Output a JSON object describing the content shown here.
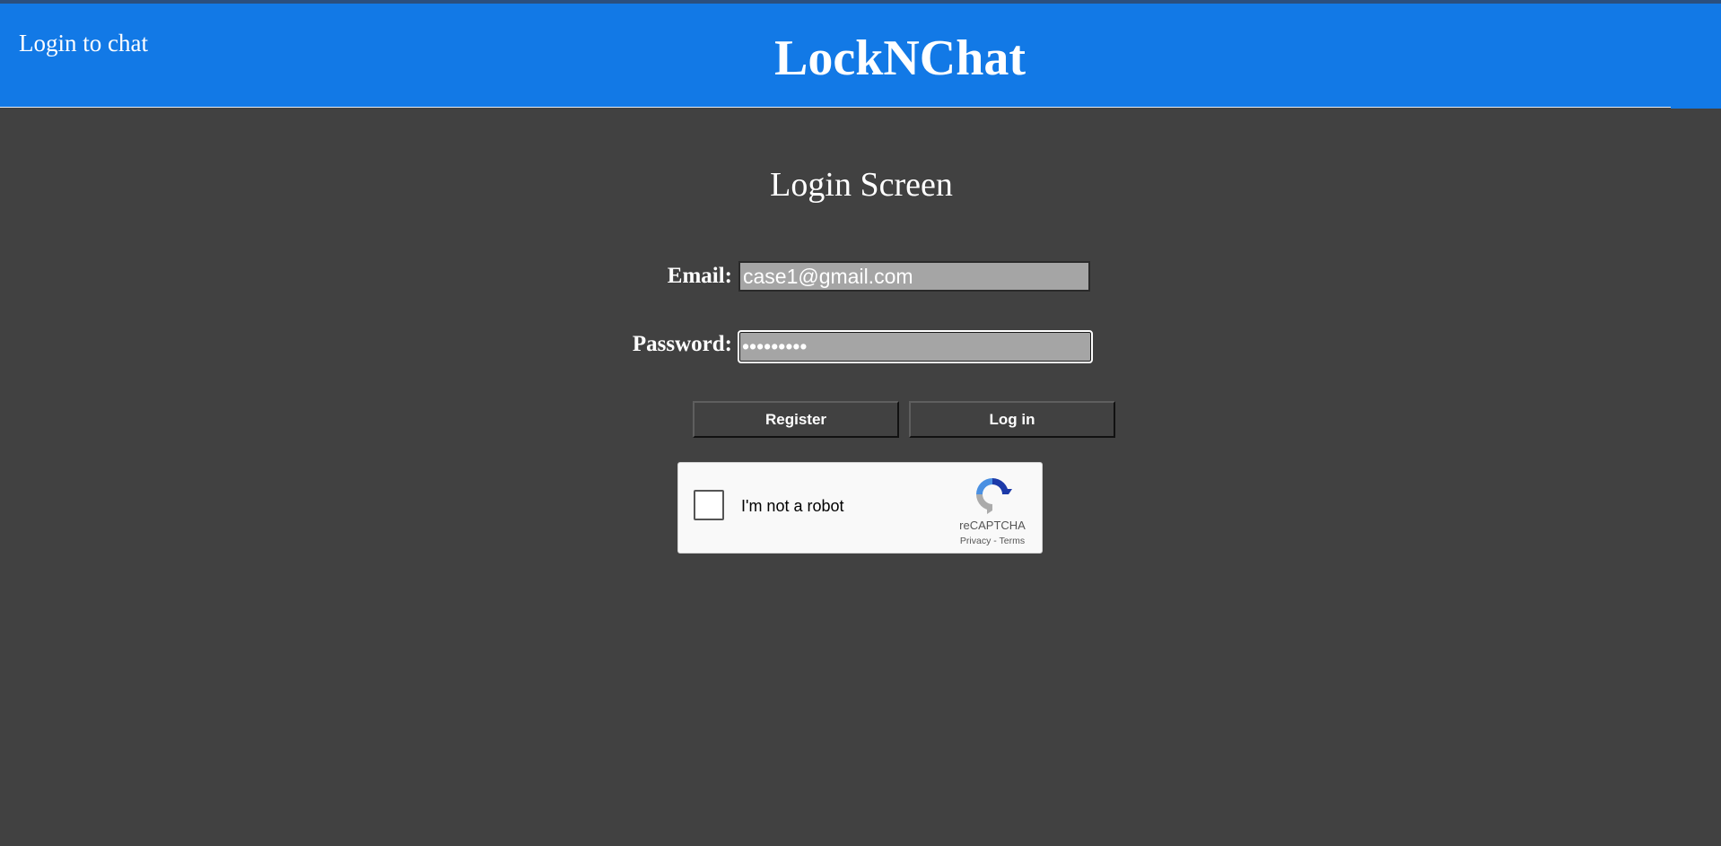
{
  "header": {
    "subtitle": "Login to chat",
    "app_title": "LockNChat",
    "color": "#1279e6"
  },
  "page": {
    "title": "Login Screen",
    "background": "#414141"
  },
  "form": {
    "email_label": "Email:",
    "email_value": "case1@gmail.com",
    "password_label": "Password:",
    "password_value": "•••••••••",
    "register_label": "Register",
    "login_label": "Log in"
  },
  "recaptcha": {
    "checkbox_label": "I'm not a robot",
    "brand": "reCAPTCHA",
    "privacy_label": "Privacy",
    "separator": " - ",
    "terms_label": "Terms",
    "checked": false
  }
}
